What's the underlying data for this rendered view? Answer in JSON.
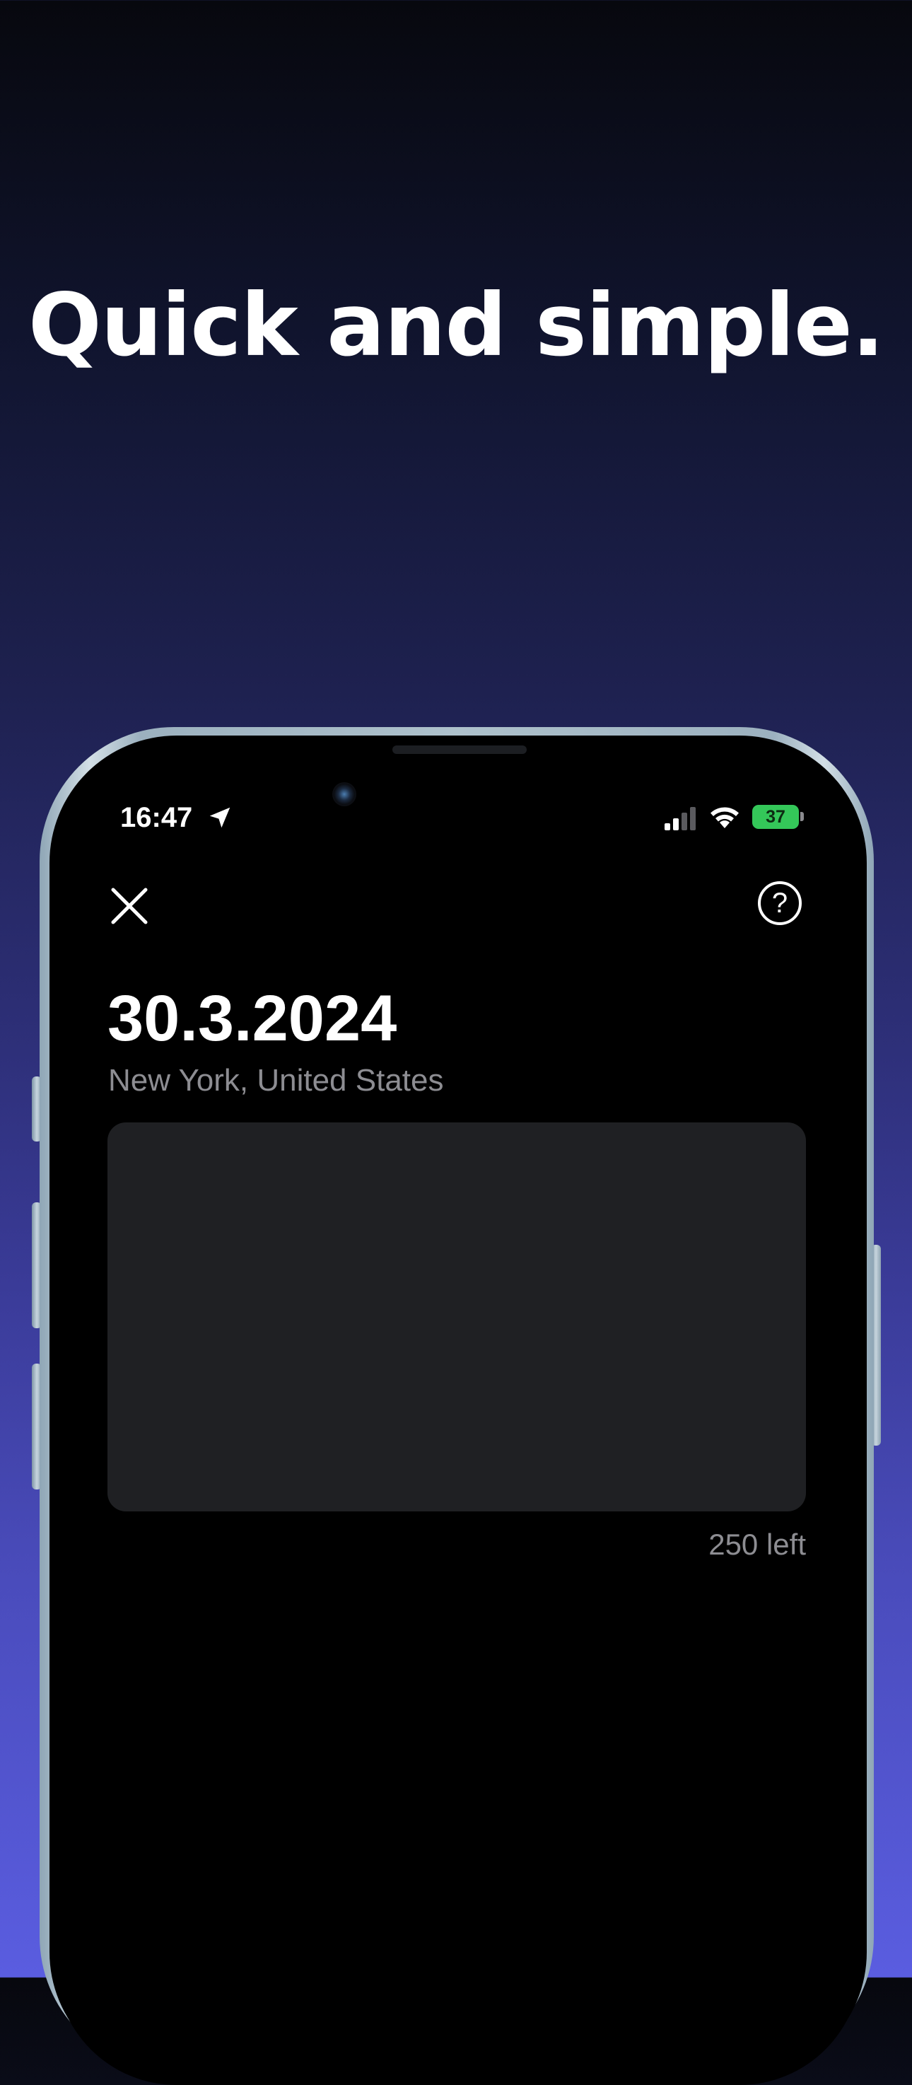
{
  "promo": {
    "headline": "Quick and simple."
  },
  "status_bar": {
    "time": "16:47",
    "battery_level": "37",
    "battery_color": "#34c759",
    "icons": [
      "location-arrow-icon",
      "cellular-signal-icon",
      "wifi-icon",
      "battery-icon"
    ]
  },
  "nav": {
    "close_icon": "close-icon",
    "help_label": "?"
  },
  "entry": {
    "date": "30.3.2024",
    "location": "New York, United States",
    "text_value": "",
    "chars_left": "250 left"
  },
  "colors": {
    "screen_background": "#000000",
    "input_background": "#1f2023",
    "secondary_text": "#8d8d92"
  }
}
